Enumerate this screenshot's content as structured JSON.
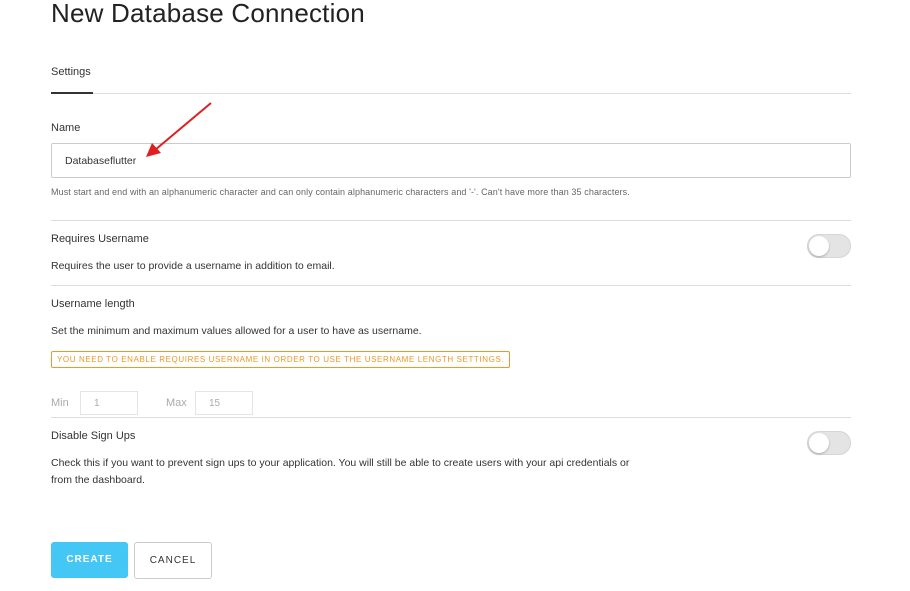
{
  "page": {
    "title": "New Database Connection"
  },
  "tabs": [
    {
      "label": "Settings",
      "active": true
    }
  ],
  "name_field": {
    "label": "Name",
    "value": "Databaseflutter",
    "hint": "Must start and end with an alphanumeric character and can only contain alphanumeric characters and '-'. Can't have more than 35 characters."
  },
  "requires_username": {
    "label": "Requires Username",
    "description": "Requires the user to provide a username in addition to email.",
    "enabled": false
  },
  "username_length": {
    "label": "Username length",
    "description": "Set the minimum and maximum values allowed for a user to have as username.",
    "warning": "YOU NEED TO ENABLE REQUIRES USERNAME IN ORDER TO USE THE USERNAME LENGTH SETTINGS.",
    "min_label": "Min",
    "min_value": "1",
    "max_label": "Max",
    "max_value": "15"
  },
  "disable_signups": {
    "label": "Disable Sign Ups",
    "description_line1": "Check this if you want to prevent sign ups to your application. You will still be able to create users with your api credentials or",
    "description_line2": "from the dashboard.",
    "enabled": false
  },
  "actions": {
    "create_label": "CREATE",
    "cancel_label": "CANCEL"
  },
  "colors": {
    "accent": "#44c7f4",
    "warning": "#e89a2a",
    "annotation_arrow": "#e02020"
  },
  "annotation": {
    "icon": "red-arrow-icon"
  }
}
